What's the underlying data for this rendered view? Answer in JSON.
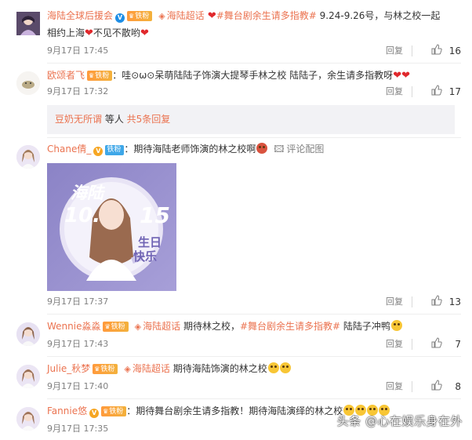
{
  "comments": [
    {
      "username": "海陆全球后援会",
      "fan_badge": "铁粉",
      "topic": "海陆超话",
      "hashtag": "#舞台剧余生请多指教#",
      "text_a": " 9.24-9.26号，与林之校一起",
      "text_b": "相约上海",
      "text_c": "不见不散哟",
      "time": "9月17日 17:45",
      "reply_label": "回复",
      "likes": "16"
    },
    {
      "username": "欧颂者飞",
      "fan_badge": "铁粉",
      "text": "：哇⊙ω⊙呆萌陆陆子饰演大提琴手林之校 陆陆子，余生请多指教呀",
      "time": "9月17日 17:32",
      "reply_label": "回复",
      "likes": "17",
      "subreply": {
        "name": "豆奶无所谓",
        "middle": " 等人 ",
        "total": "共5条回复"
      }
    },
    {
      "username": "Chane倩_",
      "fan_badge": "铁粉",
      "text": "：期待海陆老师饰演的林之校啊",
      "image_reply": "评论配图",
      "image": {
        "title": "海陆",
        "date_left": "10.",
        "date_right": "15",
        "caption_1": "生日",
        "caption_2": "快乐"
      },
      "time": "9月17日 17:37",
      "reply_label": "回复",
      "likes": "13"
    },
    {
      "username": "Wennie淼淼",
      "fan_badge": "铁粉",
      "topic": "海陆超话",
      "text_a": " 期待林之校，",
      "hashtag": "#舞台剧余生请多指教#",
      "text_b": " 陆陆子冲鸭",
      "time": "9月17日 17:43",
      "reply_label": "回复",
      "likes": "7"
    },
    {
      "username": "Julie_秋梦",
      "fan_badge": "铁粉",
      "topic": "海陆超话",
      "text": " 期待海陆饰演的林之校",
      "time": "9月17日 17:40",
      "reply_label": "回复",
      "likes": "8"
    },
    {
      "username": "Fannie悠",
      "fan_badge": "铁粉",
      "text": "：期待舞台剧余生请多指教！期待海陆演绎的林之校",
      "time": "9月17日 17:35"
    }
  ],
  "watermark": "头条 @心在娱乐身在外",
  "colors": {
    "link": "#eb7350",
    "meta": "#808080",
    "heart": "#e0282c",
    "badge": "#f3a13c",
    "verified": "#1e8ee6"
  }
}
